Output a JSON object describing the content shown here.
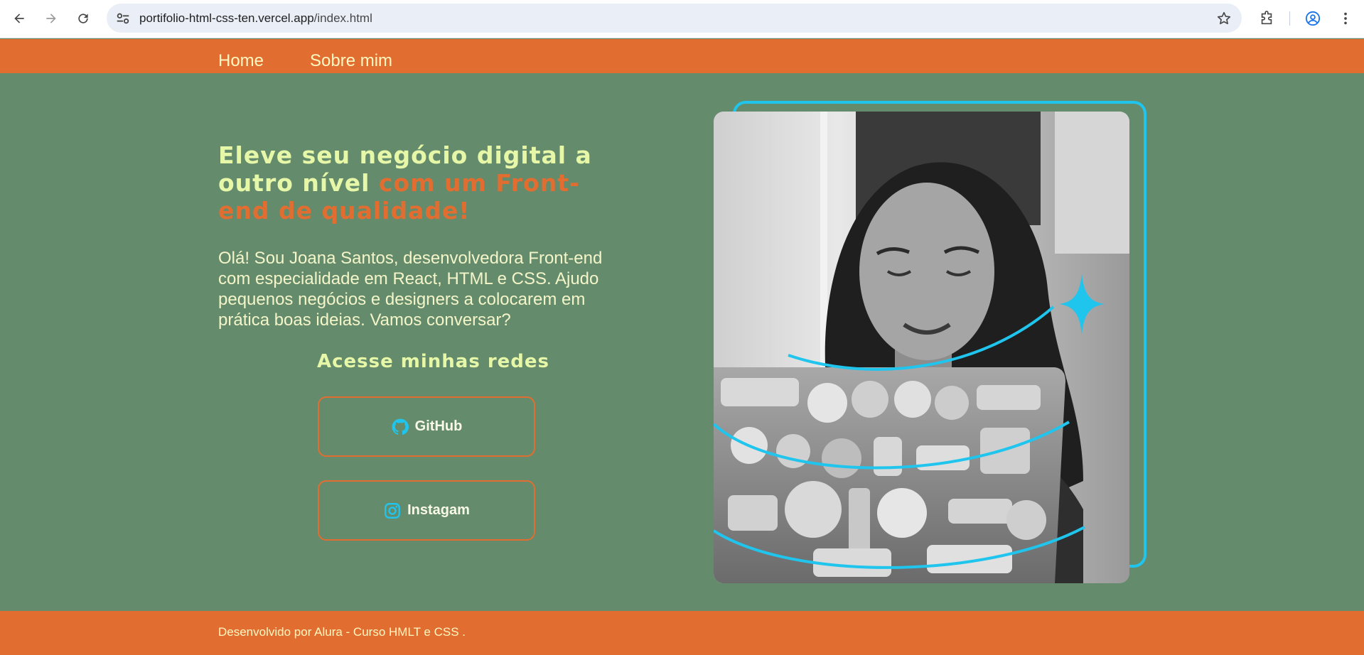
{
  "browser": {
    "url_host": "portifolio-html-css-ten.vercel.app",
    "url_path": "/index.html"
  },
  "nav": {
    "home": "Home",
    "about": "Sobre mim"
  },
  "hero": {
    "title_part1": "Eleve seu negócio digital a outro nível ",
    "title_accent": "com um Front-end de qualidade!",
    "text": "Olá! Sou Joana Santos, desenvolvedora Front-end com especialidade em React, HTML e CSS. Ajudo pequenos negócios e designers a colocarem em prática boas ideias. Vamos conversar?"
  },
  "networks": {
    "title": "Acesse minhas redes",
    "github": "GitHub",
    "instagram": "Instagam"
  },
  "footer": {
    "text": "Desenvolvido por Alura - Curso HMLT e CSS ."
  },
  "colors": {
    "background": "#648b6c",
    "header": "#e16e30",
    "accent_cyan": "#20c5ee",
    "title_light": "#e7f7a8"
  }
}
